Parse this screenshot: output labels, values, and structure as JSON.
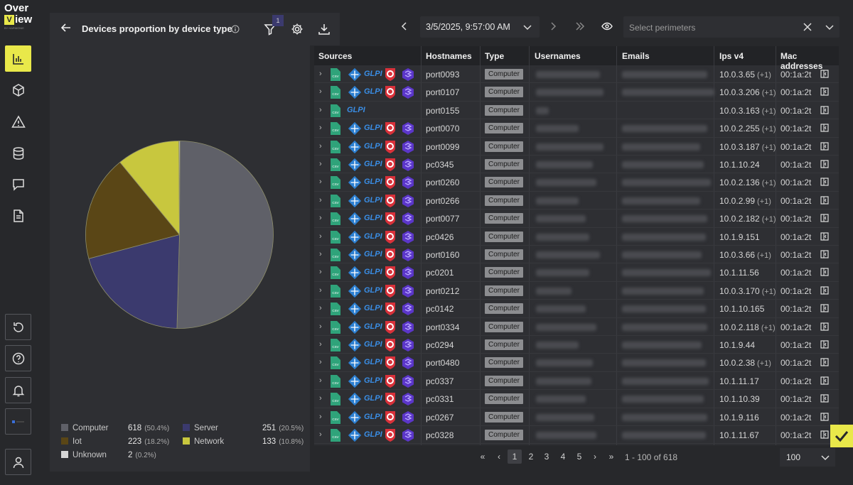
{
  "logo": {
    "line1": "Over",
    "line2": "iew",
    "v": "V",
    "tiny": "BY HARMONIE"
  },
  "panel": {
    "title": "Devices proportion by device type",
    "filter_count": "1"
  },
  "legend": [
    {
      "label": "Computer",
      "count": "618",
      "pct": "(50.4%)",
      "color": "#5f6068"
    },
    {
      "label": "Server",
      "count": "251",
      "pct": "(20.5%)",
      "color": "#3b3a6e"
    },
    {
      "label": "Iot",
      "count": "223",
      "pct": "(18.2%)",
      "color": "#5a4616"
    },
    {
      "label": "Network",
      "count": "133",
      "pct": "(10.8%)",
      "color": "#c8c73e"
    },
    {
      "label": "Unknown",
      "count": "2",
      "pct": "(0.2%)",
      "color": "#d6d6d6"
    }
  ],
  "chart_data": {
    "type": "pie",
    "categories": [
      "Computer",
      "Server",
      "Iot",
      "Network",
      "Unknown"
    ],
    "values": [
      618,
      251,
      223,
      133,
      2
    ],
    "colors": [
      "#5f6068",
      "#3b3a6e",
      "#5a4616",
      "#c8c73e",
      "#d6d6d6"
    ],
    "title": "Devices proportion by device type"
  },
  "topbar": {
    "date": "3/5/2025, 9:57:00 AM",
    "perimeter_placeholder": "Select perimeters"
  },
  "table": {
    "headers": [
      "Sources",
      "Hostnames",
      "Type",
      "Usernames",
      "Emails",
      "Ips v4",
      "Mac addresses"
    ],
    "rows": [
      {
        "host": "port0093",
        "type": "Computer",
        "ip": "10.0.3.65",
        "plus": "(+1)",
        "mac": "00:1a:2t",
        "full": true
      },
      {
        "host": "port0107",
        "type": "Computer",
        "ip": "10.0.3.206",
        "plus": "(+1)",
        "mac": "00:1a:2t",
        "full": true
      },
      {
        "host": "port0155",
        "type": "Computer",
        "ip": "10.0.3.163",
        "plus": "(+1)",
        "mac": "00:1a:2t",
        "full": false
      },
      {
        "host": "port0070",
        "type": "Computer",
        "ip": "10.0.2.255",
        "plus": "(+1)",
        "mac": "00:1a:2t",
        "full": true
      },
      {
        "host": "port0099",
        "type": "Computer",
        "ip": "10.0.3.187",
        "plus": "(+1)",
        "mac": "00:1a:2t",
        "full": true
      },
      {
        "host": "pc0345",
        "type": "Computer",
        "ip": "10.1.10.24",
        "plus": "",
        "mac": "00:1a:2t",
        "full": true
      },
      {
        "host": "port0260",
        "type": "Computer",
        "ip": "10.0.2.136",
        "plus": "(+1)",
        "mac": "00:1a:2t",
        "full": true
      },
      {
        "host": "port0266",
        "type": "Computer",
        "ip": "10.0.2.99",
        "plus": "(+1)",
        "mac": "00:1a:2t",
        "full": true
      },
      {
        "host": "port0077",
        "type": "Computer",
        "ip": "10.0.2.182",
        "plus": "(+1)",
        "mac": "00:1a:2t",
        "full": true
      },
      {
        "host": "pc0426",
        "type": "Computer",
        "ip": "10.1.9.151",
        "plus": "",
        "mac": "00:1a:2t",
        "full": true
      },
      {
        "host": "port0160",
        "type": "Computer",
        "ip": "10.0.3.66",
        "plus": "(+1)",
        "mac": "00:1a:2t",
        "full": true
      },
      {
        "host": "pc0201",
        "type": "Computer",
        "ip": "10.1.11.56",
        "plus": "",
        "mac": "00:1a:2t",
        "full": true
      },
      {
        "host": "port0212",
        "type": "Computer",
        "ip": "10.0.3.170",
        "plus": "(+1)",
        "mac": "00:1a:2t",
        "full": true
      },
      {
        "host": "pc0142",
        "type": "Computer",
        "ip": "10.1.10.165",
        "plus": "",
        "mac": "00:1a:2t",
        "full": true
      },
      {
        "host": "port0334",
        "type": "Computer",
        "ip": "10.0.2.118",
        "plus": "(+1)",
        "mac": "00:1a:2t",
        "full": true
      },
      {
        "host": "pc0294",
        "type": "Computer",
        "ip": "10.1.9.44",
        "plus": "",
        "mac": "00:1a:2t",
        "full": true
      },
      {
        "host": "port0480",
        "type": "Computer",
        "ip": "10.0.2.38",
        "plus": "(+1)",
        "mac": "00:1a:2t",
        "full": true
      },
      {
        "host": "pc0337",
        "type": "Computer",
        "ip": "10.1.11.17",
        "plus": "",
        "mac": "00:1a:2t",
        "full": true
      },
      {
        "host": "pc0331",
        "type": "Computer",
        "ip": "10.1.10.39",
        "plus": "",
        "mac": "00:1a:2t",
        "full": true
      },
      {
        "host": "pc0267",
        "type": "Computer",
        "ip": "10.1.9.116",
        "plus": "",
        "mac": "00:1a:2t",
        "full": true
      },
      {
        "host": "pc0328",
        "type": "Computer",
        "ip": "10.1.11.67",
        "plus": "",
        "mac": "00:1a:2t",
        "full": true
      }
    ]
  },
  "pagination": {
    "pages": [
      "1",
      "2",
      "3",
      "4",
      "5"
    ],
    "range": "1 - 100 of 618",
    "per_page": "100"
  },
  "source_labels": {
    "csv": "CSV",
    "glpi": "GLPI"
  }
}
